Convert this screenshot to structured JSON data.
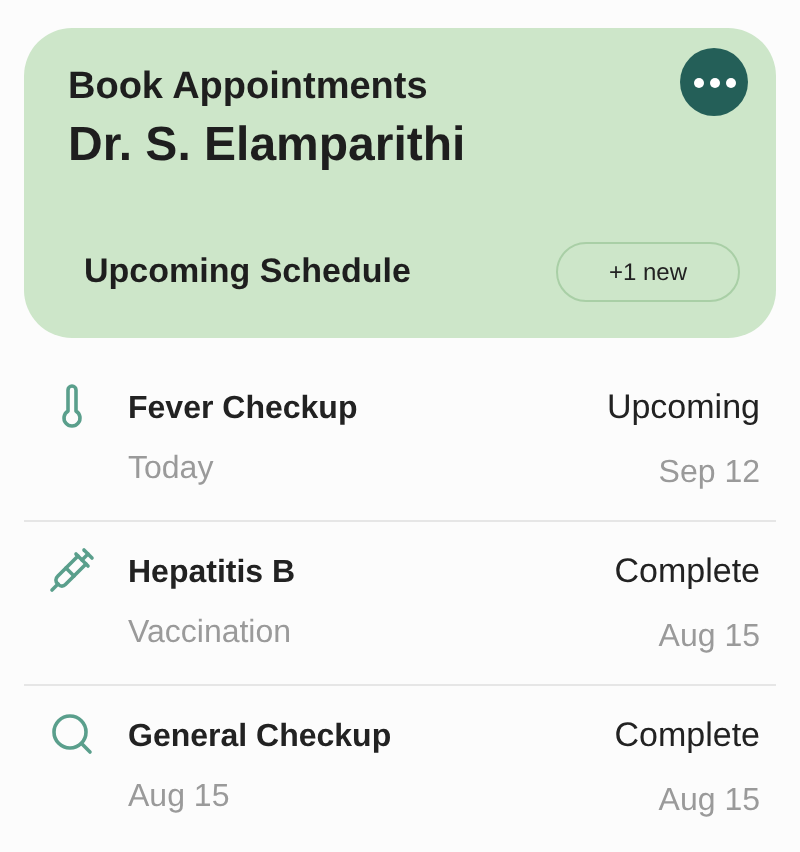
{
  "header": {
    "title": "Book Appointments",
    "doctor": "Dr. S. Elamparithi",
    "section": "Upcoming Schedule",
    "badge": "+1 new"
  },
  "appointments": [
    {
      "kind": "thermometer",
      "title": "Fever Checkup",
      "subtitle": "Today",
      "status": "Upcoming",
      "date": "Sep 12"
    },
    {
      "kind": "syringe",
      "title": "Hepatitis B",
      "subtitle": "Vaccination",
      "status": "Complete",
      "date": "Aug 15"
    },
    {
      "kind": "search",
      "title": "General Checkup",
      "subtitle": "Aug 15",
      "status": "Complete",
      "date": "Aug 15"
    }
  ]
}
